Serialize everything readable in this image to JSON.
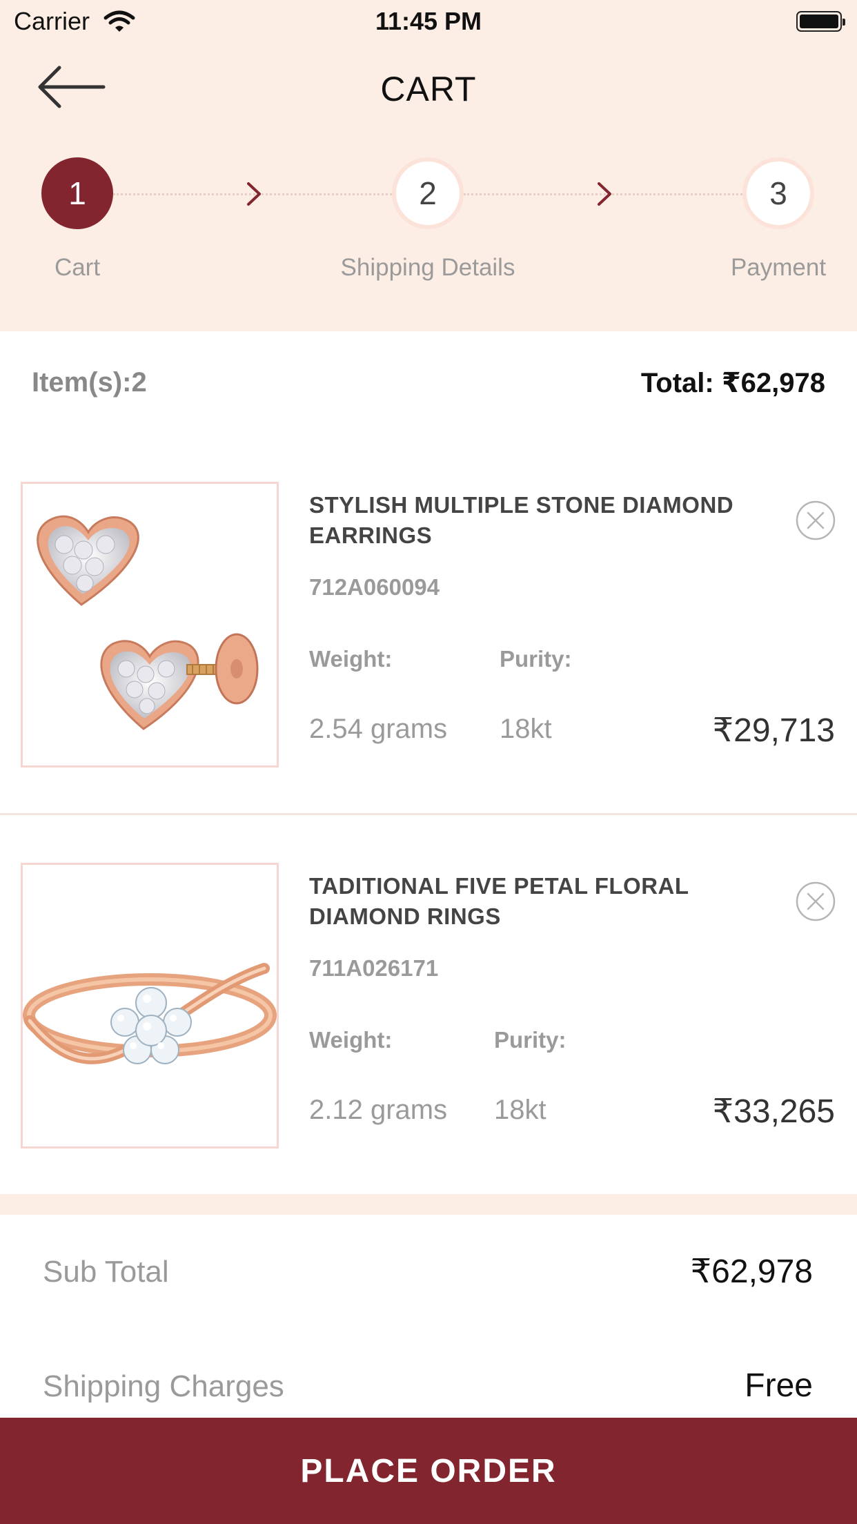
{
  "status_bar": {
    "carrier": "Carrier",
    "time": "11:45 PM"
  },
  "nav": {
    "title": "CART"
  },
  "stepper": [
    {
      "number": "1",
      "label": "Cart",
      "active": true
    },
    {
      "number": "2",
      "label": "Shipping Details",
      "active": false
    },
    {
      "number": "3",
      "label": "Payment",
      "active": false
    }
  ],
  "summary": {
    "items": "Item(s):2",
    "total": "Total: ₹62,978"
  },
  "products": [
    {
      "name": "STYLISH MULTIPLE STONE DIAMOND EARRINGS",
      "code": "712A060094",
      "weight_label": "Weight:",
      "purity_label": "Purity:",
      "weight": "2.54 grams",
      "purity": "18kt",
      "price": "₹29,713",
      "image_icon": "heart-earrings-image"
    },
    {
      "name": "TADITIONAL FIVE PETAL FLORAL DIAMOND RINGS",
      "code": "711A026171",
      "weight_label": "Weight:",
      "purity_label": "Purity:",
      "weight": "2.12 grams",
      "purity": "18kt",
      "price": "₹33,265",
      "image_icon": "floral-ring-image"
    }
  ],
  "totals": {
    "subtotal_label": "Sub Total",
    "subtotal_value": "₹62,978",
    "shipping_label": "Shipping Charges",
    "shipping_value": "Free"
  },
  "cta": {
    "label": "PLACE ORDER"
  },
  "colors": {
    "brand": "#82252f",
    "header_bg": "#fdeee5",
    "muted": "#9a9a9a"
  }
}
